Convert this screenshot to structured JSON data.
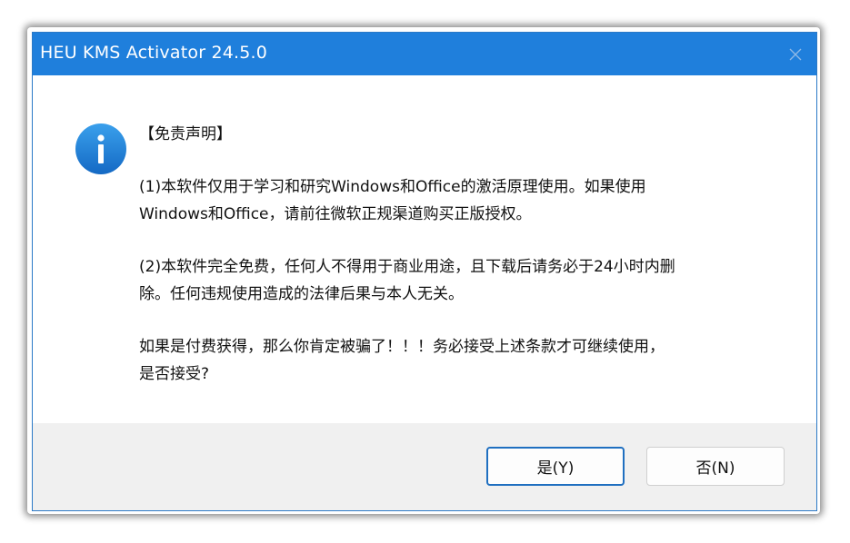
{
  "window": {
    "title": "HEU KMS Activator 24.5.0",
    "close_icon": "close-icon",
    "titlebar_color": "#1f7fdc"
  },
  "dialog": {
    "icon": "info-icon",
    "icon_glyph": "i",
    "heading": "【免责声明】",
    "lines": [
      "(1)本软件仅用于学习和研究Windows和Office的激活原理使用。如果使用",
      "Windows和Office，请前往微软正规渠道购买正版授权。",
      "(2)本软件完全免费，任何人不得用于商业用途，且下载后请务必于24小时内删",
      "除。任何违规使用造成的法律后果与本人无关。",
      "如果是付费获得，那么你肯定被骗了！！！务必接受上述条款才可继续使用，",
      "是否接受?"
    ]
  },
  "buttons": {
    "yes_label": "是(Y)",
    "no_label": "否(N)"
  }
}
